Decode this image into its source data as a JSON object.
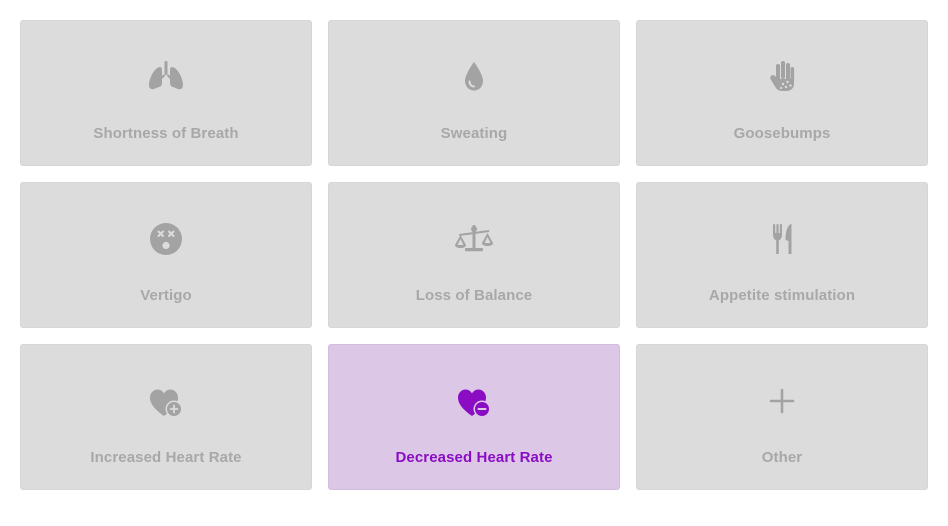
{
  "colors": {
    "tile_bg": "#dcdcdc",
    "tile_selected_bg": "#dcc7e6",
    "icon_gray": "#a3a3a3",
    "label_gray": "#a8a8a8",
    "accent_purple": "#8a0dc4"
  },
  "symptoms": [
    {
      "label": "Shortness of Breath",
      "icon": "lungs-icon",
      "selected": false
    },
    {
      "label": "Sweating",
      "icon": "droplet-icon",
      "selected": false
    },
    {
      "label": "Goosebumps",
      "icon": "hand-dots-icon",
      "selected": false
    },
    {
      "label": "Vertigo",
      "icon": "dizzy-face-icon",
      "selected": false
    },
    {
      "label": "Loss of Balance",
      "icon": "scale-balance-icon",
      "selected": false
    },
    {
      "label": "Appetite stimulation",
      "icon": "utensils-icon",
      "selected": false
    },
    {
      "label": "Increased Heart Rate",
      "icon": "heart-plus-icon",
      "selected": false
    },
    {
      "label": "Decreased Heart Rate",
      "icon": "heart-minus-icon",
      "selected": true
    },
    {
      "label": "Other",
      "icon": "plus-icon",
      "selected": false
    }
  ]
}
